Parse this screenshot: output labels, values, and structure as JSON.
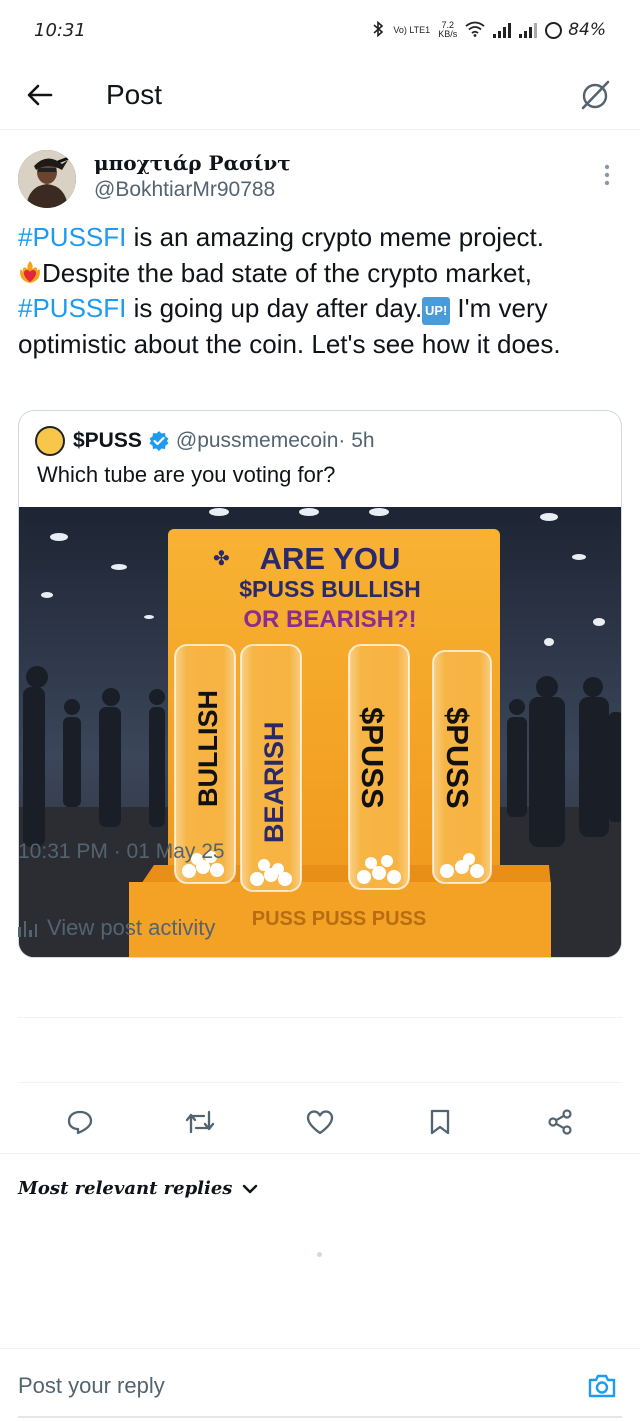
{
  "status_bar": {
    "time": "10:31",
    "network_type": "Vo) LTE1",
    "speed_value": "7.2",
    "speed_unit": "KB/s",
    "battery": "84%"
  },
  "header": {
    "title": "Post"
  },
  "post": {
    "author": {
      "display_name": "μποχτιάρ Ρασίντ",
      "handle": "@BokhtiarMr90788"
    },
    "text": {
      "hashtag_1": "#PUSSFI",
      "part_1": " is an amazing crypto meme project.",
      "part_2": "Despite the bad state of the crypto market, ",
      "hashtag_2": "#PUSSFI",
      "part_3": " is going up day after day.",
      "emoji_up": "UP!",
      "part_4": " I'm very optimistic about the coin. Let's see how it does."
    },
    "timestamp": "10:31 PM · 01 May 25",
    "view_activity_label": "View post activity"
  },
  "quote": {
    "name": "$PUSS",
    "handle": "@pussmemecoin",
    "age": " · 5h",
    "text": "Which tube are you voting for?",
    "image": {
      "headline_1": "ARE YOU",
      "headline_2": "$PUSS BULLISH",
      "headline_3": "OR BEARISH?!",
      "tube_1": "BULLISH",
      "tube_2": "BEARISH",
      "tube_3": "$PUSS",
      "tube_4": "$PUSS",
      "base_text": "PUSS PUSS PUSS"
    }
  },
  "replies": {
    "sort_label": "Most relevant replies"
  },
  "reply_bar": {
    "placeholder": "Post your reply"
  },
  "colors": {
    "accent": "#1d9bf0",
    "secondary_text": "#536471",
    "board_orange": "#f5a623"
  }
}
